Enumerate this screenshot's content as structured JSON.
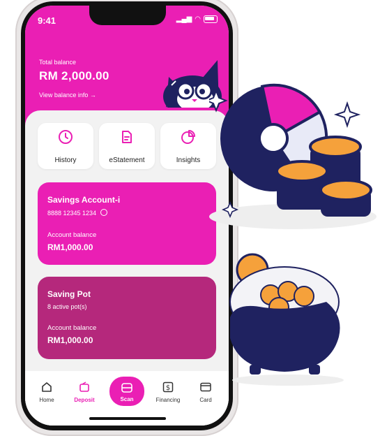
{
  "status": {
    "time": "9:41"
  },
  "account": {
    "total_label": "Total balance",
    "balance": "RM 2,000.00",
    "view_info": "View balance info →"
  },
  "quick_actions": [
    {
      "label": "History",
      "icon": "clock-icon"
    },
    {
      "label": "eStatement",
      "icon": "document-icon"
    },
    {
      "label": "Insights",
      "icon": "pie-chart-icon"
    }
  ],
  "cards": [
    {
      "title": "Savings Account-i",
      "subtitle": "8888 12345 1234",
      "balance_label": "Account  balance",
      "balance": "RM1,000.00",
      "color": "#ea1fb4"
    },
    {
      "title": "Saving Pot",
      "subtitle": "8 active pot(s)",
      "balance_label": "Account  balance",
      "balance": "RM1,000.00",
      "color": "#b5287c"
    }
  ],
  "nav": [
    {
      "label": "Home",
      "icon": "home-icon"
    },
    {
      "label": "Deposit",
      "icon": "wallet-icon",
      "active": true
    },
    {
      "label": "Scan",
      "icon": "scan-icon"
    },
    {
      "label": "Financing",
      "icon": "dollar-icon"
    },
    {
      "label": "Card",
      "icon": "card-icon"
    }
  ],
  "colors": {
    "primary": "#ea1fb4",
    "secondary": "#b5287c",
    "navy": "#1f2260",
    "coin": "#f5a13b"
  }
}
